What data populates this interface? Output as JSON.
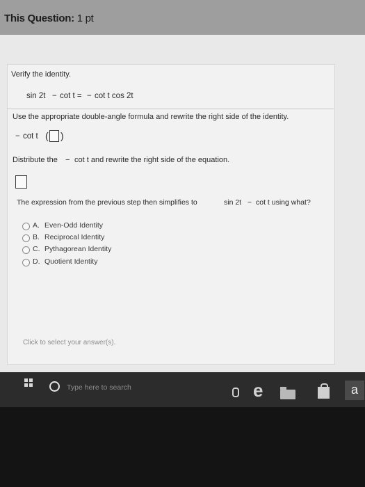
{
  "header": {
    "title": "This Question:",
    "points": "1 pt"
  },
  "question": {
    "instruction": "Verify the identity.",
    "identity_lhs": "sin 2t",
    "identity_mid": "cot t =",
    "identity_rhs": "cot t cos 2t",
    "step1_text": "Use the appropriate double-angle formula and rewrite the right side of the identity.",
    "step1_expr": "cot t",
    "step2_text_a": "Distribute the",
    "step2_text_b": "cot t and rewrite the right side of the equation.",
    "step3_text_a": "The expression from the previous step then simplifies to",
    "step3_text_b": "sin 2t",
    "step3_text_c": "cot t using what?"
  },
  "choices": [
    {
      "letter": "A.",
      "label": "Even-Odd Identity"
    },
    {
      "letter": "B.",
      "label": "Reciprocal Identity"
    },
    {
      "letter": "C.",
      "label": "Pythagorean Identity"
    },
    {
      "letter": "D.",
      "label": "Quotient Identity"
    }
  ],
  "hint": "Click to select your answer(s).",
  "taskbar": {
    "search_placeholder": "Type here to search",
    "amazon_label": "a"
  },
  "icons": [
    "windows-icon",
    "search-icon",
    "mic-icon",
    "edge-icon",
    "file-explorer-icon",
    "store-icon",
    "amazon-icon"
  ]
}
